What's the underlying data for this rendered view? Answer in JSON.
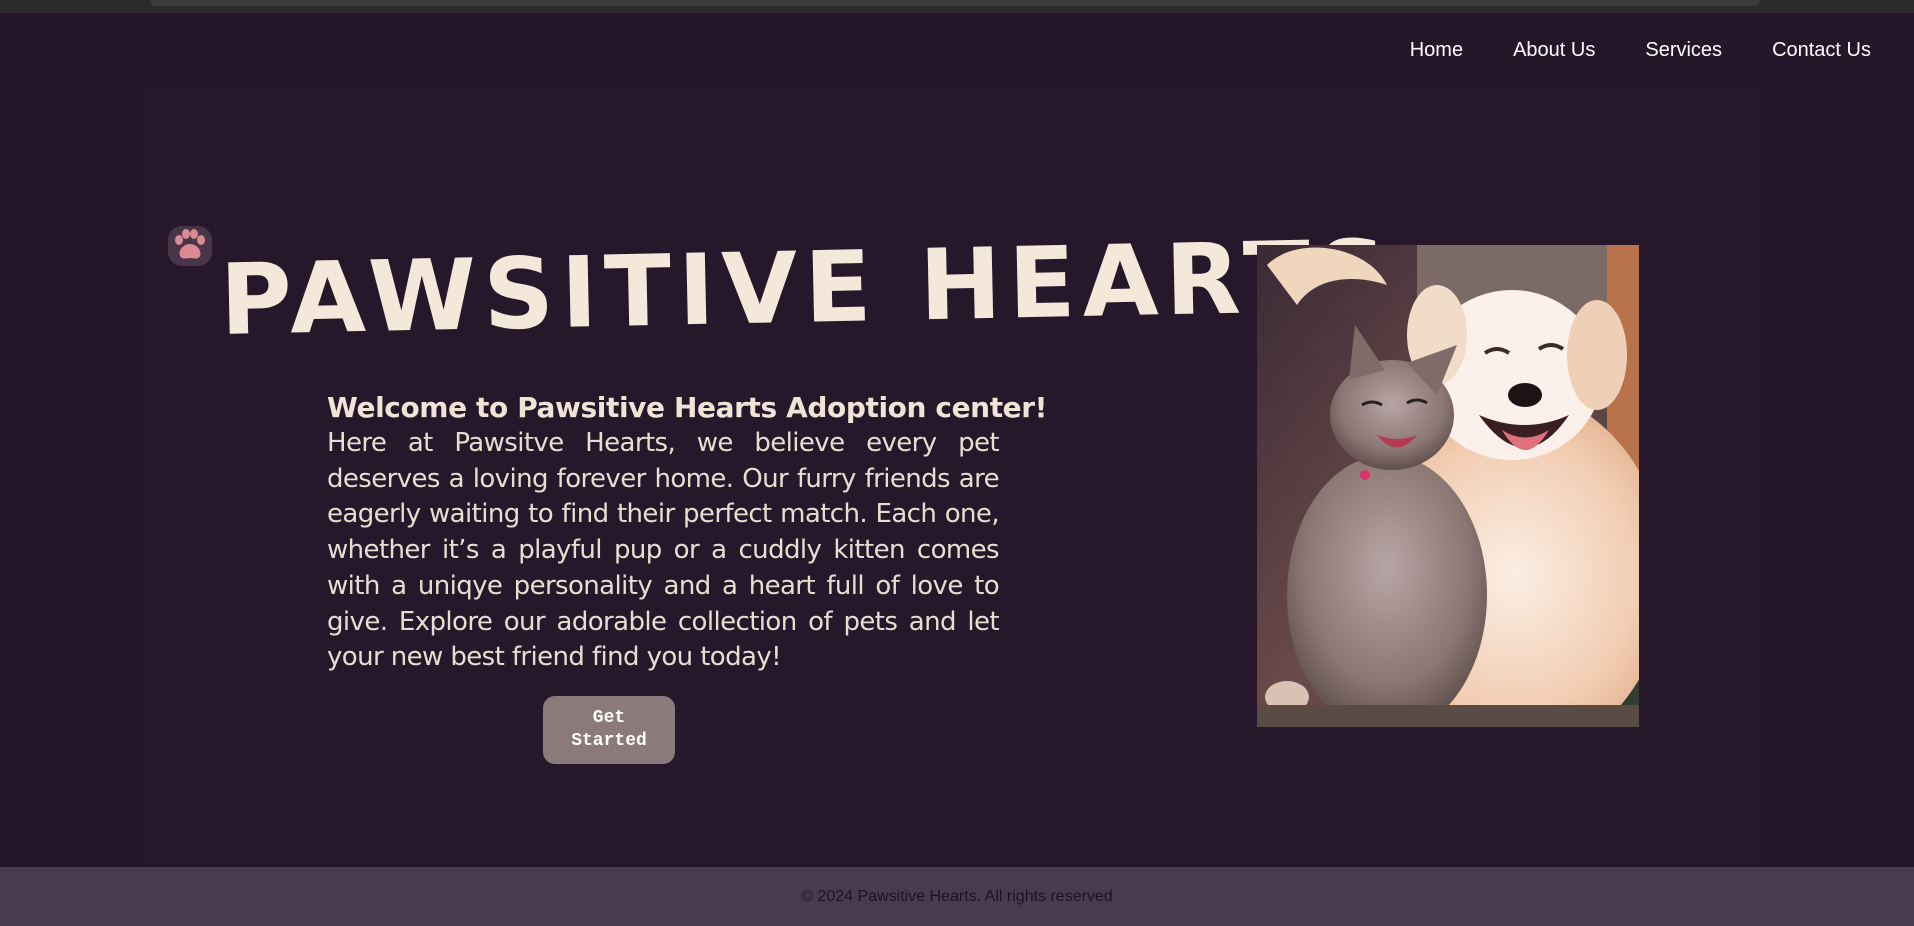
{
  "nav": {
    "items": [
      {
        "label": "Home"
      },
      {
        "label": "About Us"
      },
      {
        "label": "Services"
      },
      {
        "label": "Contact Us"
      }
    ]
  },
  "hero": {
    "title": "PAWSITIVE HEARTS",
    "welcome_heading": "Welcome to Pawsitive Hearts Adoption center!",
    "welcome_body": "Here at Pawsitve Hearts, we believe every pet deserves a loving forever home. Our furry friends are eagerly waiting to find their perfect match. Each one, whether it’s a playful pup or a cuddly kitten comes with a uniqye personality and a heart full of love to give. Explore our adorable collection of pets and let your new best friend find you today!",
    "cta_label": "Get Started",
    "photo_alt": "cat hugging dog"
  },
  "footer": {
    "text": "© 2024 Pawsitive Hearts. All rights reserved"
  },
  "icons": {
    "logo": "paw-icon"
  },
  "colors": {
    "background": "#25162a",
    "title": "#f4e8da",
    "button": "#8a7a7c",
    "footer": "#4a3a4e"
  }
}
